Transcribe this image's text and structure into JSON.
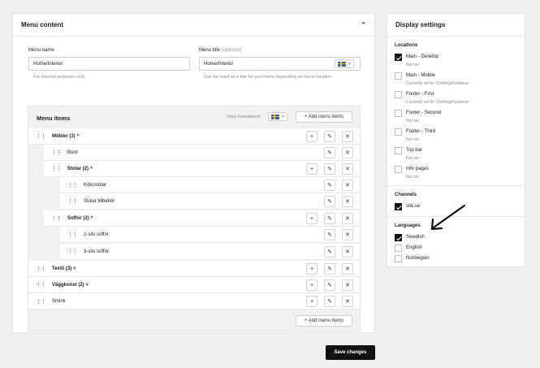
{
  "menu_content": {
    "title": "Menu content",
    "name_label": "Menu name",
    "name_value": "Home/Interior",
    "name_hint": "For internal purposes only",
    "title_label": "Menu title",
    "title_optional": "(optional)",
    "title_value": "Home/Interior",
    "title_hint": "Can be used as a title for you menu depending on menu location",
    "items_title": "Menu items",
    "view_translations": "View translations",
    "add_label": "+ Add menu items",
    "add_label_bottom": "+ Add menu items",
    "rows": [
      {
        "label": "Möbler (3)",
        "chev": "^"
      },
      {
        "label": "Bord"
      },
      {
        "label": "Stolar (2)",
        "chev": "^"
      },
      {
        "label": "Köksstolar"
      },
      {
        "label": "Stolar tillbehör"
      },
      {
        "label": "Soffor (2)",
        "chev": "^"
      },
      {
        "label": "2-sits soffor"
      },
      {
        "label": "3-sits soffor"
      },
      {
        "label": "Textil (3)",
        "chev": "˅"
      },
      {
        "label": "Väggkonst (2)",
        "chev": "˅"
      },
      {
        "label": "Smink"
      }
    ]
  },
  "save_label": "Save changes",
  "display": {
    "title": "Display settings",
    "locations_title": "Locations",
    "locations": [
      {
        "label": "Main - Desktop",
        "sub": "Not set",
        "checked": true
      },
      {
        "label": "Main - Mobile",
        "sub": "Currently set to: Clothing/Footwear",
        "checked": false
      },
      {
        "label": "Footer - First",
        "sub": "Currently set to: Clothing/Footwear",
        "checked": false
      },
      {
        "label": "Footer - Second",
        "sub": "Not set",
        "checked": false
      },
      {
        "label": "Footer - Third",
        "sub": "Not set",
        "checked": false
      },
      {
        "label": "Top bar",
        "sub": "Not set",
        "checked": false
      },
      {
        "label": "Info pages",
        "sub": "Not set",
        "checked": false
      }
    ],
    "channels_title": "Channels",
    "channels": [
      {
        "label": "site.se",
        "checked": true
      }
    ],
    "languages_title": "Languages",
    "languages": [
      {
        "label": "Swedish",
        "checked": true
      },
      {
        "label": "English",
        "checked": false
      },
      {
        "label": "Norwegian",
        "checked": false
      }
    ]
  }
}
